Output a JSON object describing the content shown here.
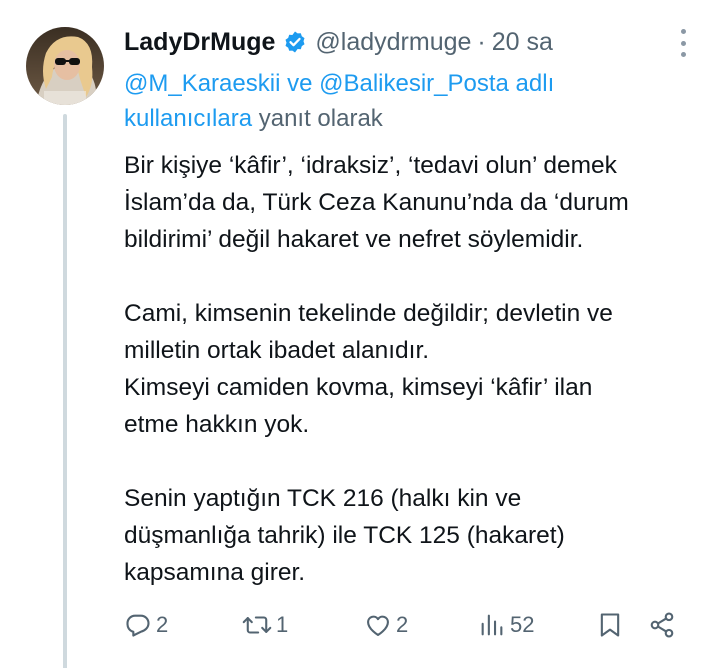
{
  "tweet": {
    "display_name": "LadyDrMuge",
    "verified": true,
    "handle": "@ladydrmuge",
    "separator": "·",
    "time": "20 sa",
    "reply_to": {
      "mention_1": "@M_Karaeskii",
      "connector": " ve ",
      "mention_2": "@Balikesir_Posta adlı kullanıcılara",
      "suffix": " yanıt olarak"
    },
    "lines": [
      "Bir kişiye ‘kâfir’, ‘idraksiz’, ‘tedavi olun’ demek",
      "İslam’da da, Türk Ceza Kanunu’nda da ‘durum",
      "bildirimi’ değil hakaret ve nefret söylemidir.",
      "Cami, kimsenin tekelinde değildir; devletin ve",
      "milletin ortak ibadet alanıdır.",
      "Kimseyi camiden kovma, kimseyi ‘kâfir’ ilan",
      "etme hakkın yok.",
      "Senin yaptığın TCK 216 (halkı kin ve",
      "düşmanlığa tahrik) ile TCK 125 (hakaret)",
      "kapsamına girer."
    ],
    "actions": {
      "replies": "2",
      "retweets": "1",
      "likes": "2",
      "views": "52"
    },
    "icons": [
      "verified-badge-icon",
      "more-icon",
      "reply-icon",
      "retweet-icon",
      "like-icon",
      "views-icon",
      "bookmark-icon",
      "share-icon"
    ],
    "colors": {
      "link": "#1d9bf0",
      "secondary": "#536471",
      "text": "#0f1419",
      "thread_line": "#cfd9de"
    }
  }
}
